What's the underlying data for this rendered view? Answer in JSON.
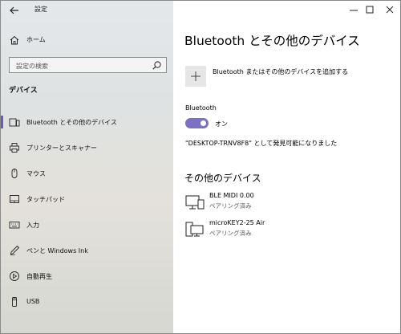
{
  "app": {
    "title": "設定"
  },
  "window_controls": {
    "minimize": "─",
    "maximize": "☐",
    "close": "✕"
  },
  "sidebar": {
    "home_label": "ホーム",
    "search_placeholder": "設定の検索",
    "section_heading": "デバイス",
    "items": [
      {
        "label": "Bluetooth とその他のデバイス",
        "icon": "bluetooth-devices-icon",
        "selected": true
      },
      {
        "label": "プリンターとスキャナー",
        "icon": "printer-icon",
        "selected": false
      },
      {
        "label": "マウス",
        "icon": "mouse-icon",
        "selected": false
      },
      {
        "label": "タッチパッド",
        "icon": "touchpad-icon",
        "selected": false
      },
      {
        "label": "入力",
        "icon": "keyboard-icon",
        "selected": false
      },
      {
        "label": "ペンと Windows Ink",
        "icon": "pen-icon",
        "selected": false
      },
      {
        "label": "自動再生",
        "icon": "autoplay-icon",
        "selected": false
      },
      {
        "label": "USB",
        "icon": "usb-icon",
        "selected": false
      }
    ]
  },
  "main": {
    "title": "Bluetooth とその他のデバイス",
    "add_device_label": "Bluetooth またはその他のデバイスを追加する",
    "bluetooth_label": "Bluetooth",
    "toggle_state": "オン",
    "discoverable_text": "\"DESKTOP-TRNV8F8\" として発見可能になりました",
    "other_devices_heading": "その他のデバイス",
    "devices": [
      {
        "name": "BLE MIDI 0.00",
        "status": "ペアリング済み",
        "icon": "midi-device-icon"
      },
      {
        "name": "microKEY2-25 Air",
        "status": "ペアリング済み",
        "icon": "computer-device-icon"
      }
    ]
  },
  "colors": {
    "accent": "#7b70c2",
    "selection_bar": "#6b5fb5"
  }
}
